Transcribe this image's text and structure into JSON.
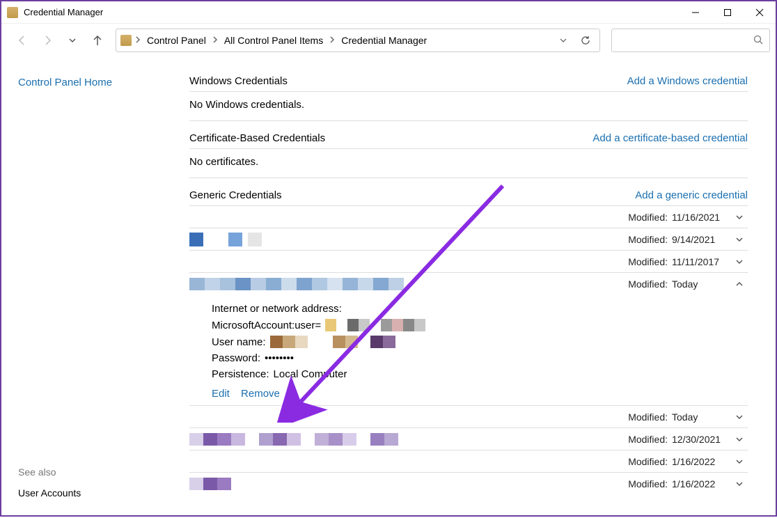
{
  "window": {
    "title": "Credential Manager"
  },
  "breadcrumb": {
    "items": [
      "Control Panel",
      "All Control Panel Items",
      "Credential Manager"
    ]
  },
  "sidebar": {
    "home": "Control Panel Home",
    "see_also": "See also",
    "user_accounts": "User Accounts"
  },
  "sections": {
    "windows": {
      "title": "Windows Credentials",
      "link": "Add a Windows credential",
      "empty": "No Windows credentials."
    },
    "cert": {
      "title": "Certificate-Based Credentials",
      "link": "Add a certificate-based credential",
      "empty": "No certificates."
    },
    "generic": {
      "title": "Generic Credentials",
      "link": "Add a generic credential"
    }
  },
  "modified_label": "Modified:",
  "generic_items": [
    {
      "date": "11/16/2021",
      "expanded": false
    },
    {
      "date": "9/14/2021",
      "expanded": false
    },
    {
      "date": "11/11/2017",
      "expanded": false
    },
    {
      "date": "Today",
      "expanded": true
    },
    {
      "date": "Today",
      "expanded": false
    },
    {
      "date": "12/30/2021",
      "expanded": false
    },
    {
      "date": "1/16/2022",
      "expanded": false
    },
    {
      "date": "1/16/2022",
      "expanded": false
    }
  ],
  "detail": {
    "addr_label": "Internet or network address:",
    "addr_prefix": "MicrosoftAccount:user=",
    "user_label": "User name:",
    "pass_label": "Password:",
    "pass_value": "••••••••",
    "persist_label": "Persistence:",
    "persist_value": "Local Computer",
    "edit": "Edit",
    "remove": "Remove"
  }
}
